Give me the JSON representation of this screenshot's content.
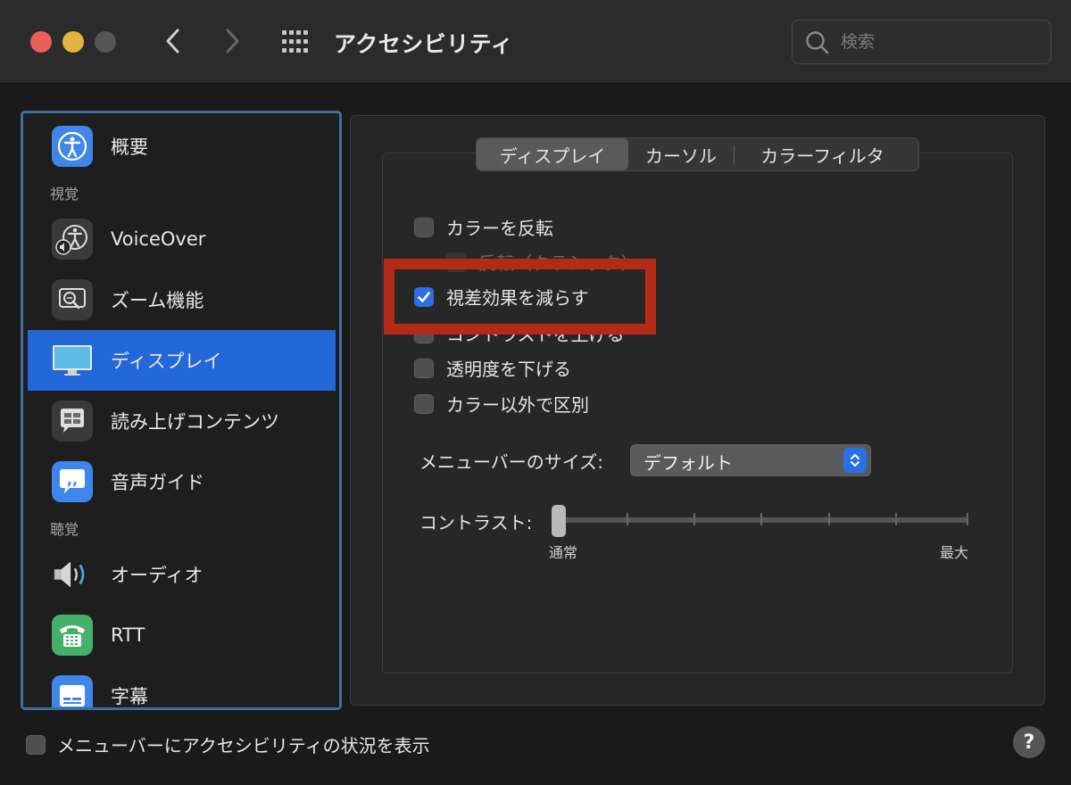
{
  "window": {
    "title": "アクセシビリティ"
  },
  "search": {
    "placeholder": "検索"
  },
  "sidebar": {
    "items": [
      {
        "type": "item",
        "label": "概要",
        "icon": "accessibility-icon"
      },
      {
        "type": "section",
        "label": "視覚"
      },
      {
        "type": "item",
        "label": "VoiceOver",
        "icon": "voiceover-icon"
      },
      {
        "type": "item",
        "label": "ズーム機能",
        "icon": "zoom-icon"
      },
      {
        "type": "item",
        "label": "ディスプレイ",
        "icon": "display-icon",
        "selected": true
      },
      {
        "type": "item",
        "label": "読み上げコンテンツ",
        "icon": "speech-bubble-icon"
      },
      {
        "type": "item",
        "label": "音声ガイド",
        "icon": "quote-bubble-icon"
      },
      {
        "type": "section",
        "label": "聴覚"
      },
      {
        "type": "item",
        "label": "オーディオ",
        "icon": "speaker-icon"
      },
      {
        "type": "item",
        "label": "RTT",
        "icon": "telephone-icon"
      },
      {
        "type": "item",
        "label": "字幕",
        "icon": "captions-icon"
      }
    ]
  },
  "tabs": [
    {
      "label": "ディスプレイ",
      "active": true
    },
    {
      "label": "カーソル",
      "active": false
    },
    {
      "label": "カラーフィルタ",
      "active": false
    }
  ],
  "options": {
    "invert_colors": {
      "label": "カラーを反転",
      "checked": false
    },
    "classic_invert": {
      "label": "反転（クラシック）",
      "checked": false
    },
    "reduce_motion": {
      "label": "視差効果を減らす",
      "checked": true
    },
    "increase_contrast": {
      "label": "コントラストを上げる",
      "checked": false
    },
    "reduce_transparency": {
      "label": "透明度を下げる",
      "checked": false
    },
    "differentiate_without_color": {
      "label": "カラー以外で区別",
      "checked": false
    }
  },
  "menubar_size": {
    "label": "メニューバーのサイズ:",
    "value": "デフォルト"
  },
  "contrast": {
    "label": "コントラスト:",
    "min_label": "通常",
    "max_label": "最大",
    "value": 0
  },
  "bottom": {
    "show_status_label": "メニューバーにアクセシビリティの状況を表示",
    "checked": false,
    "help": "?"
  },
  "colors": {
    "accent": "#2b6fe6",
    "sidebar_selection": "#2467d9",
    "highlight": "#b32a17"
  }
}
